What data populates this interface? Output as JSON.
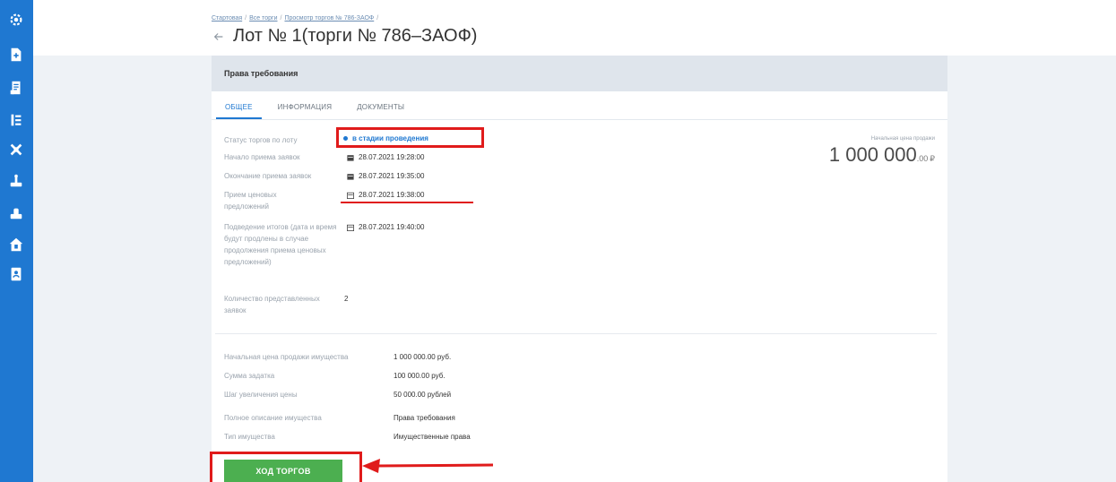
{
  "sidebar": {
    "items": [
      {
        "icon": "gear-icon"
      },
      {
        "icon": "document-add-icon"
      },
      {
        "icon": "receipt-icon"
      },
      {
        "icon": "list-icon"
      },
      {
        "icon": "tools-icon"
      },
      {
        "icon": "scale-icon"
      },
      {
        "icon": "stamp-icon"
      },
      {
        "icon": "home-lock-icon"
      },
      {
        "icon": "address-book-icon"
      }
    ]
  },
  "breadcrumb": {
    "items": [
      "Стартовая",
      "Все торги",
      "Просмотр торгов № 786-ЗАОФ"
    ],
    "separator": "/"
  },
  "header": {
    "title": "Лот № 1(торги № 786–ЗАОФ)"
  },
  "card": {
    "heading": "Права требования",
    "tabs": [
      "ОБЩЕЕ",
      "ИНФОРМАЦИЯ",
      "ДОКУМЕНТЫ"
    ],
    "active_tab": "ОБЩЕЕ"
  },
  "details": {
    "status_label": "Статус торгов по лоту",
    "status_value": "в стадии проведения",
    "start_label": "Начало приема заявок",
    "start_value": "28.07.2021 19:28:00",
    "end_label": "Окончание приема заявок",
    "end_value": "28.07.2021 19:35:00",
    "bids_label": "Прием ценовых предложений",
    "bids_value": "28.07.2021 19:38:00",
    "summary_label": "Подведение итогов (дата и время будут продлены в случае продолжения приема ценовых предложений)",
    "summary_value": "28.07.2021 19:40:00",
    "count_label": "Количество представленных заявок",
    "count_value": "2"
  },
  "price": {
    "label": "Начальная цена продажи",
    "main": "1 000 000",
    "cents": ".00",
    "currency": "₽"
  },
  "property": {
    "start_price_label": "Начальная цена продажи имущества",
    "start_price_value": "1 000 000.00 руб.",
    "deposit_label": "Сумма задатка",
    "deposit_value": "100 000.00 руб.",
    "step_label": "Шаг увеличения цены",
    "step_value": "50 000.00 рублей",
    "description_label": "Полное описание имущества",
    "description_value": "Права требования",
    "type_label": "Тип имущества",
    "type_value": "Имущественные права"
  },
  "actions": {
    "progress_button": "ХОД ТОРГОВ"
  },
  "colors": {
    "sidebar": "#1f78d1",
    "accent": "#1f78d1",
    "button": "#4caf50",
    "annotation": "#e01b1b"
  }
}
